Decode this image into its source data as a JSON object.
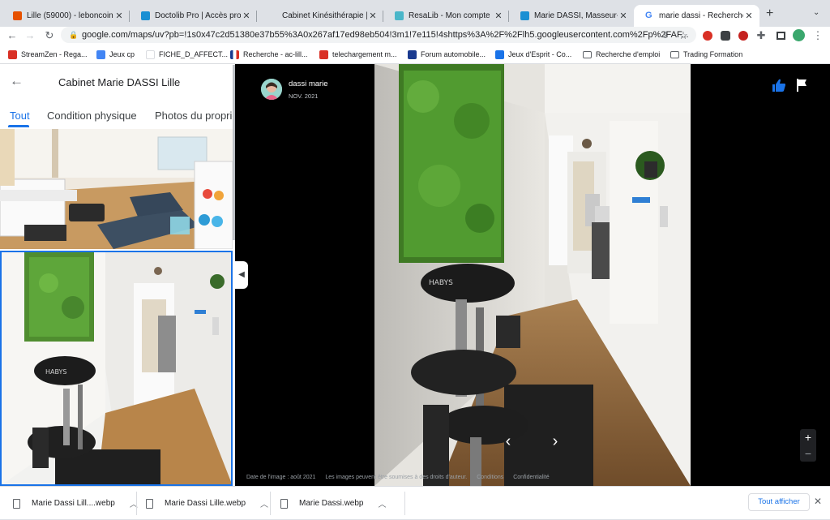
{
  "tabs": [
    {
      "title": "Lille (59000) - leboncoin",
      "favicon_color": "#e65100"
    },
    {
      "title": "Doctolib Pro | Accès profe",
      "favicon_color": "#1a8fd3"
    },
    {
      "title": "Cabinet Kinésithérapie | M",
      "favicon_color": "#dee1e6"
    },
    {
      "title": "ResaLib - Mon compte",
      "favicon_color": "#4ab6c9"
    },
    {
      "title": "Marie DASSI, Masseur-kin",
      "favicon_color": "#1a8fd3"
    },
    {
      "title": "marie dassi - Recherche G",
      "favicon_color": "#4285f4"
    }
  ],
  "new_tab": "+",
  "toolbar": {
    "url": "google.com/maps/uv?pb=!1s0x47c2d51380e37b55%3A0x267af17ed98eb504!3m1!7e115!4shttps%3A%2F%2Flh5.googleusercontent.com%2Fp%2FAF..."
  },
  "bookmarks": [
    {
      "label": "StreamZen - Rega...",
      "color": "#d93025"
    },
    {
      "label": "Jeux cp",
      "color": "#4285f4"
    },
    {
      "label": "FICHE_D_AFFECT...",
      "color": "#ffffff"
    },
    {
      "label": "Recherche - ac-lill...",
      "color": "#1a73e8"
    },
    {
      "label": "telechargement m...",
      "color": "#d93025"
    },
    {
      "label": "Forum automobile...",
      "color": "#1a3a8f"
    },
    {
      "label": "Jeux d'Esprit - Co...",
      "color": "#1a73e8"
    },
    {
      "label": "Recherche d'emploi",
      "color": "#5f6368"
    },
    {
      "label": "Trading Formation",
      "color": "#5f6368"
    }
  ],
  "panel": {
    "title": "Cabinet Marie DASSI Lille",
    "tabs": [
      "Tout",
      "Condition physique",
      "Photos du propriétaire"
    ]
  },
  "photo": {
    "uploader": "dassi marie",
    "date": "NOV. 2021",
    "footer": [
      "Date de l'image : août 2021",
      "Les images peuvent être soumises à des droits d'auteur.",
      "Conditions",
      "Confidentialité"
    ],
    "chair_brand": "HABYS"
  },
  "zoom": {
    "in": "+",
    "out": "−"
  },
  "downloads": {
    "files": [
      "Marie Dassi Lill....webp",
      "Marie Dassi Lille.webp",
      "Marie Dassi.webp"
    ],
    "show_all": "Tout afficher"
  }
}
